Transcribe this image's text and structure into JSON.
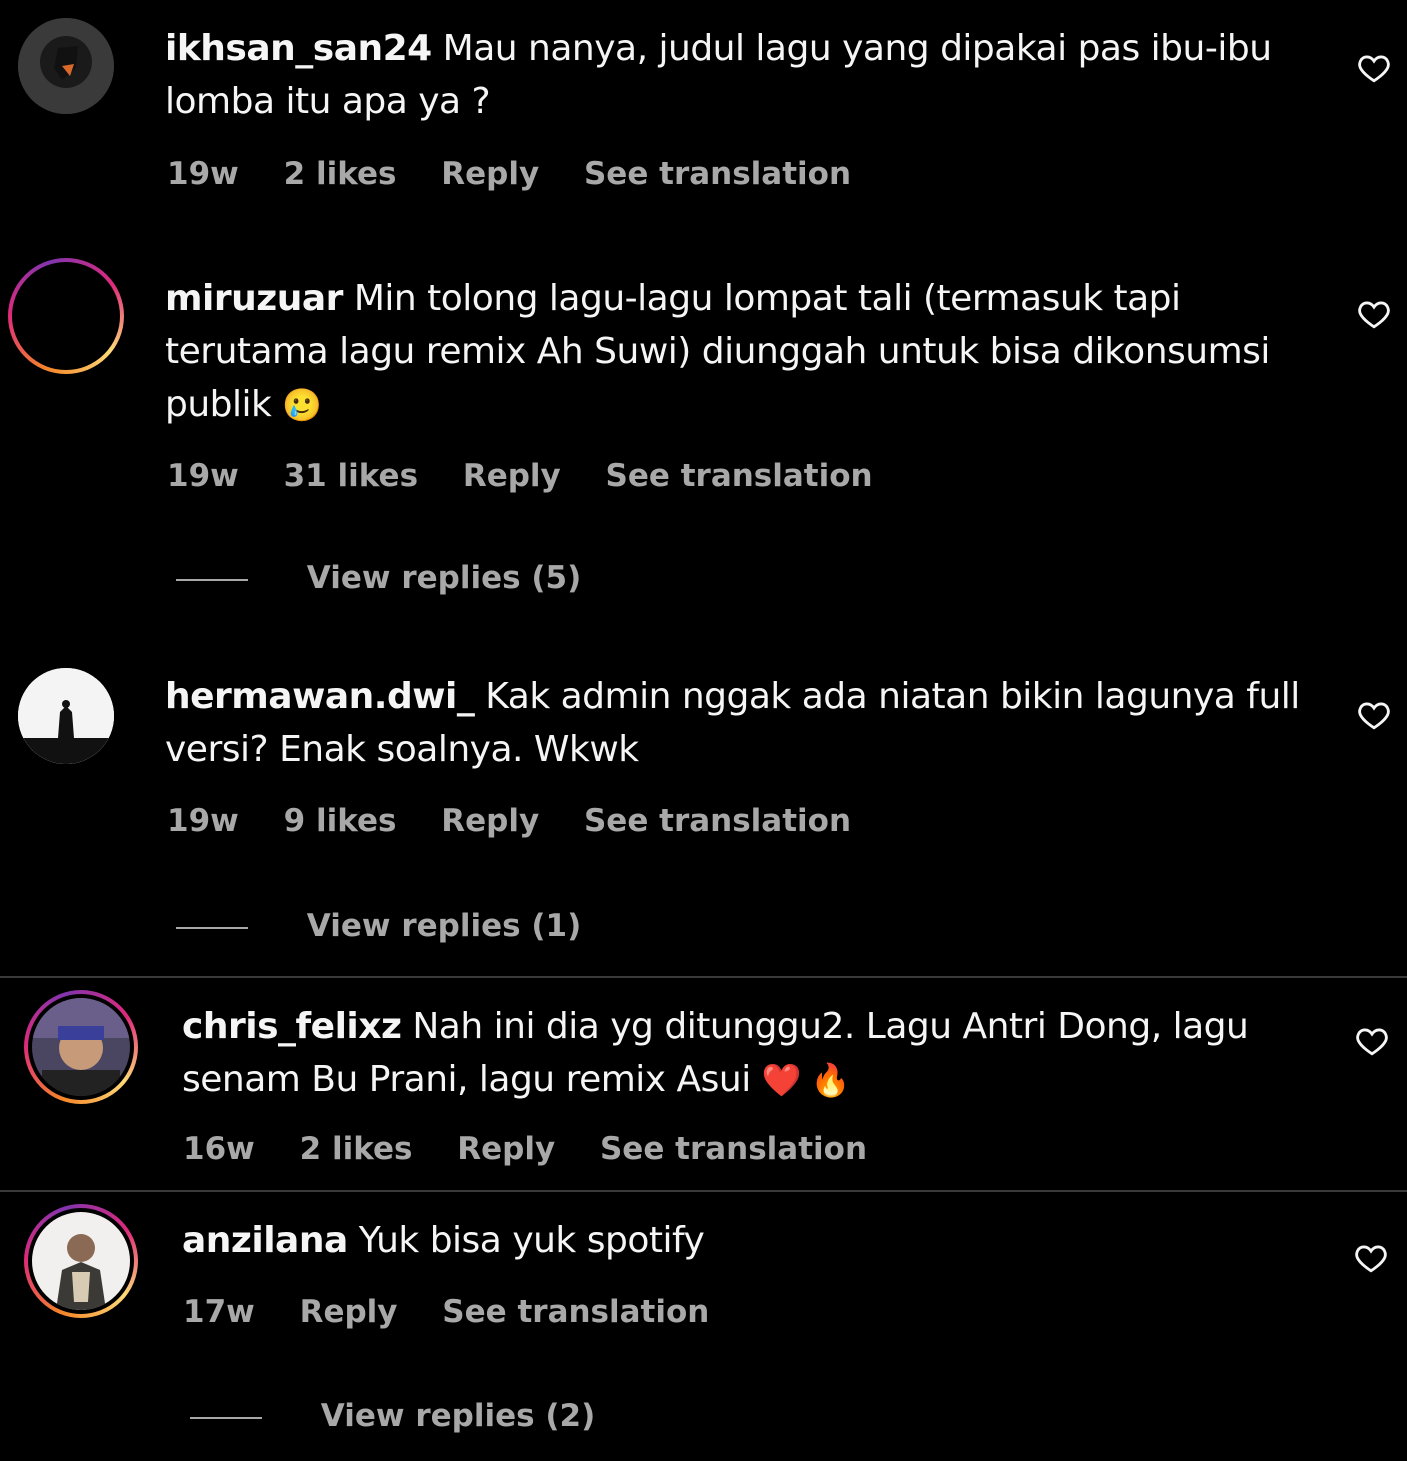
{
  "comments": [
    {
      "username": "ikhsan_san24",
      "text": "Mau nanya, judul lagu yang dipakai pas ibu-ibu lomba itu apa ya ?",
      "time": "19w",
      "likes": "2 likes",
      "reply": "Reply",
      "translate": "See translation"
    },
    {
      "username": "miruzuar",
      "text": "Min tolong lagu-lagu lompat tali (termasuk tapi terutama lagu remix Ah Suwi) diunggah untuk bisa dikonsumsi publik",
      "emoji": "🥲",
      "time": "19w",
      "likes": "31 likes",
      "reply": "Reply",
      "translate": "See translation",
      "view_replies": "View replies (5)"
    },
    {
      "username": "hermawan.dwi_",
      "text": "Kak admin nggak ada niatan bikin lagunya full versi? Enak soalnya. Wkwk",
      "time": "19w",
      "likes": "9 likes",
      "reply": "Reply",
      "translate": "See translation",
      "view_replies": "View replies (1)"
    },
    {
      "username": "chris_felixz",
      "text": "Nah ini dia yg ditunggu2. Lagu Antri Dong, lagu senam Bu Prani, lagu remix Asui",
      "emoji": "❤️ 🔥",
      "time": "16w",
      "likes": "2 likes",
      "reply": "Reply",
      "translate": "See translation"
    },
    {
      "username": "anzilana",
      "text": "Yuk bisa yuk spotify",
      "time": "17w",
      "reply": "Reply",
      "translate": "See translation",
      "view_replies": "View replies (2)"
    }
  ],
  "icons": {
    "heart": "heart-outline-icon"
  },
  "colors": {
    "background": "#000000",
    "text": "#f5f5f5",
    "secondary": "#a8a8a8",
    "story_ring": "#dd2a7b"
  }
}
